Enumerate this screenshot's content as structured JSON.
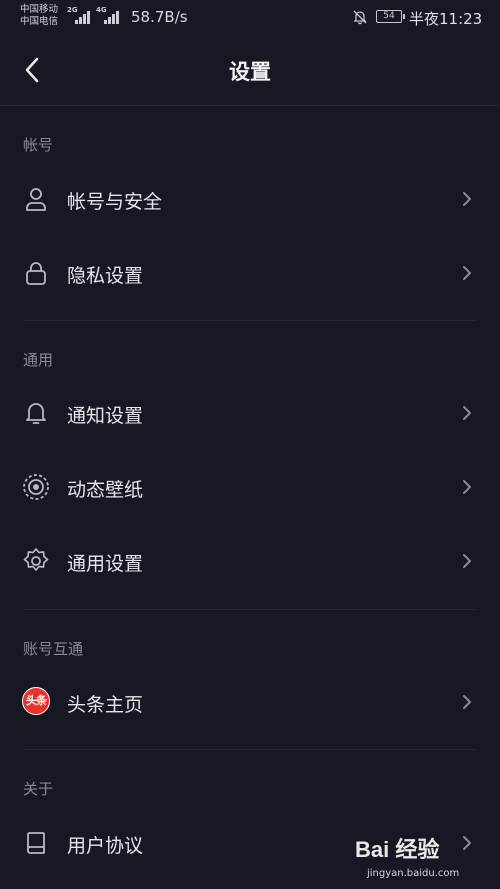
{
  "status": {
    "carrier1": "中国移动",
    "carrier2": "中国电信",
    "net1": "2G",
    "net2": "4G",
    "speed": "58.7B/s",
    "battery": "54",
    "time": "半夜11:23"
  },
  "header": {
    "title": "设置"
  },
  "sections": {
    "account": "帐号",
    "general": "通用",
    "linked": "账号互通",
    "about": "关于"
  },
  "items": {
    "account_security": "帐号与安全",
    "privacy": "隐私设置",
    "notifications": "通知设置",
    "live_wallpaper": "动态壁纸",
    "general_settings": "通用设置",
    "toutiao_home": "头条主页",
    "toutiao_badge": "头条",
    "user_agreement": "用户协议"
  },
  "watermark": {
    "brand": "Bai 经验",
    "url": "jingyan.baidu.com"
  },
  "colors": {
    "background": "#161823",
    "text": "#e6e6ea",
    "section": "#8a8b92",
    "toutiao": "#e8322b"
  },
  "icons": [
    "back-arrow-icon",
    "user-icon",
    "lock-icon",
    "bell-icon",
    "wallpaper-icon",
    "gear-icon",
    "toutiao-icon",
    "book-icon",
    "chevron-right-icon",
    "bell-off-icon"
  ]
}
